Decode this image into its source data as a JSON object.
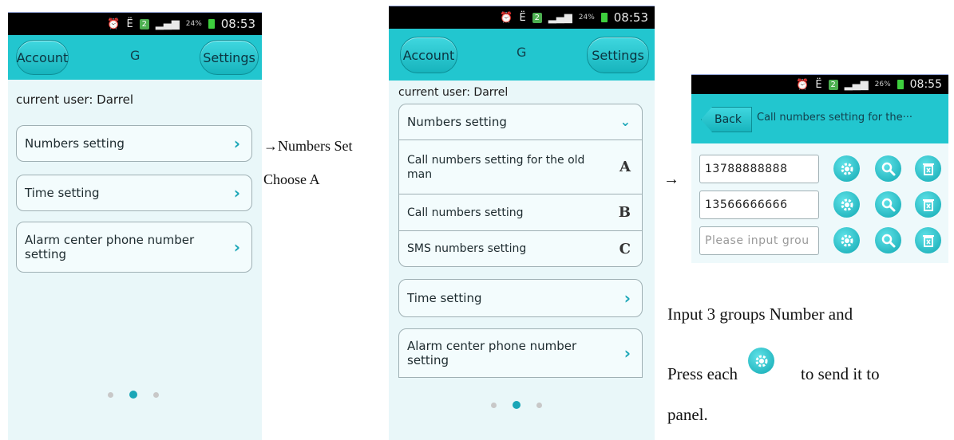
{
  "status": {
    "time1": "08:53",
    "time2": "08:53",
    "time3": "08:55",
    "pct1": "24%",
    "pct2": "24%",
    "pct3": "26%"
  },
  "header": {
    "account": "Account",
    "title": "G",
    "settings": "Settings"
  },
  "screen1": {
    "current_user": "current user:  Darrel",
    "items": [
      "Numbers setting",
      "Time setting",
      "Alarm center phone number setting"
    ]
  },
  "annot1": {
    "line1": "→Numbers Set",
    "line2": "Choose A"
  },
  "screen2": {
    "current_user": "current user:  Darrel",
    "numbers_setting": "Numbers setting",
    "sub_items": [
      {
        "label": "Call numbers setting for the old man",
        "letter": "A"
      },
      {
        "label": "Call numbers setting",
        "letter": "B"
      },
      {
        "label": "SMS numbers setting",
        "letter": "C"
      }
    ],
    "time_setting": "Time setting",
    "alarm_setting": "Alarm center phone number setting"
  },
  "arrow2": "→",
  "screen3": {
    "back": "Back",
    "title": "Call numbers setting for the···",
    "numbers": [
      "13788888888",
      "13566666666"
    ],
    "placeholder": "Please input grou"
  },
  "instructions": {
    "line1": "Input 3 groups Number and",
    "line2a": "Press each",
    "line2b": "to send it to",
    "line3": "panel."
  },
  "colors": {
    "accent": "#22c6cf",
    "chevron": "#1aa6b7"
  },
  "icons": [
    "alarm-icon",
    "sim-icon",
    "signal-icon",
    "battery-icon",
    "chevron-right-icon",
    "chevron-down-icon",
    "gear-icon",
    "search-icon",
    "trash-icon"
  ]
}
